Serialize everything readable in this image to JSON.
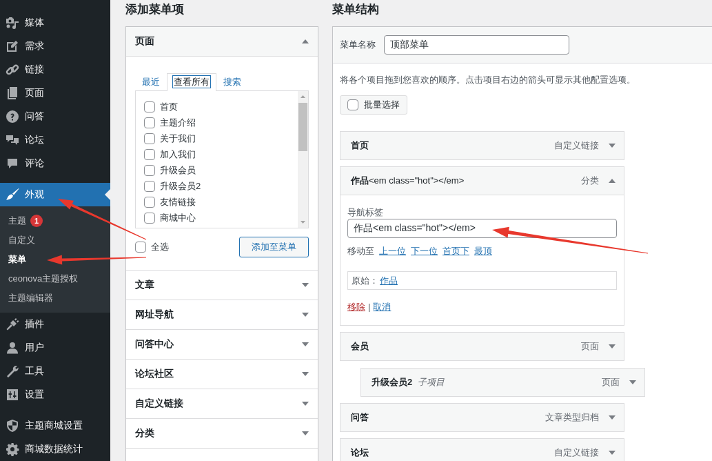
{
  "sidebar": {
    "groups": [
      [
        {
          "label": "媒体",
          "selected": false
        },
        {
          "label": "需求",
          "selected": false
        },
        {
          "label": "链接",
          "selected": false
        },
        {
          "label": "页面",
          "selected": false
        },
        {
          "label": "问答",
          "selected": false
        },
        {
          "label": "论坛",
          "selected": false
        },
        {
          "label": "评论",
          "selected": false
        }
      ],
      [
        {
          "label": "外观",
          "selected": true,
          "children": [
            {
              "label": "主题",
              "badge": "1",
              "selected": false
            },
            {
              "label": "自定义",
              "selected": false
            },
            {
              "label": "菜单",
              "selected": true
            },
            {
              "label": "ceonova主题授权",
              "selected": false
            },
            {
              "label": "主题编辑器",
              "selected": false
            }
          ]
        },
        {
          "label": "插件",
          "selected": false
        },
        {
          "label": "用户",
          "selected": false
        },
        {
          "label": "工具",
          "selected": false
        },
        {
          "label": "设置",
          "selected": false
        }
      ],
      [
        {
          "label": "主题商城设置",
          "selected": false
        },
        {
          "label": "商城数据统计",
          "selected": false
        }
      ]
    ]
  },
  "add_menu_items": {
    "title": "添加菜单项",
    "sections": [
      {
        "title": "页面",
        "expanded": true,
        "tabs": [
          {
            "label": "最近",
            "selected": false
          },
          {
            "label": "查看所有",
            "selected": true
          },
          {
            "label": "搜索",
            "selected": false
          }
        ],
        "items": [
          {
            "label": "首页",
            "checked": false
          },
          {
            "label": "主题介绍",
            "checked": false
          },
          {
            "label": "关于我们",
            "checked": false
          },
          {
            "label": "加入我们",
            "checked": false
          },
          {
            "label": "升级会员",
            "checked": false
          },
          {
            "label": "升级会员2",
            "checked": false
          },
          {
            "label": "友情链接",
            "checked": false
          },
          {
            "label": "商城中心",
            "checked": false
          }
        ],
        "select_all": {
          "label": "全选",
          "checked": false
        },
        "button": "添加至菜单"
      },
      {
        "title": "文章",
        "expanded": false
      },
      {
        "title": "网址导航",
        "expanded": false
      },
      {
        "title": "问答中心",
        "expanded": false
      },
      {
        "title": "论坛社区",
        "expanded": false
      },
      {
        "title": "自定义链接",
        "expanded": false
      },
      {
        "title": "分类",
        "expanded": false
      }
    ]
  },
  "menu_structure": {
    "title": "菜单结构",
    "menu_name": {
      "label": "菜单名称",
      "value": "顶部菜单"
    },
    "instructions": "将各个项目拖到您喜欢的顺序。点击项目右边的箭头可显示其他配置选项。",
    "bulk_select": {
      "label": "批量选择",
      "checked": false
    },
    "items": [
      {
        "title": "首页",
        "type": "自定义链接",
        "expanded": false
      },
      {
        "title": "作品",
        "title_suffix": "<em class=\"hot\"></em>",
        "type": "分类",
        "expanded": true,
        "settings": {
          "nav_label": {
            "label": "导航标签",
            "value": "作品<em class=\"hot\"></em>"
          },
          "move": {
            "label": "移动至",
            "links": [
              "上一位",
              "下一位",
              "首页下",
              "最顶"
            ]
          },
          "original": {
            "label": "原始：",
            "link": "作品"
          },
          "actions": [
            {
              "label": "移除",
              "kind": "delete"
            },
            {
              "label": "取消",
              "kind": "cancel"
            }
          ],
          "actions_separator": "|"
        }
      },
      {
        "title": "会员",
        "type": "页面",
        "expanded": false,
        "children": [
          {
            "title": "升级会员2",
            "subtitle": "子项目",
            "type": "页面",
            "expanded": false
          }
        ]
      },
      {
        "title": "问答",
        "type": "文章类型归档",
        "expanded": false
      },
      {
        "title": "论坛",
        "type": "自定义链接",
        "expanded": false
      }
    ]
  }
}
